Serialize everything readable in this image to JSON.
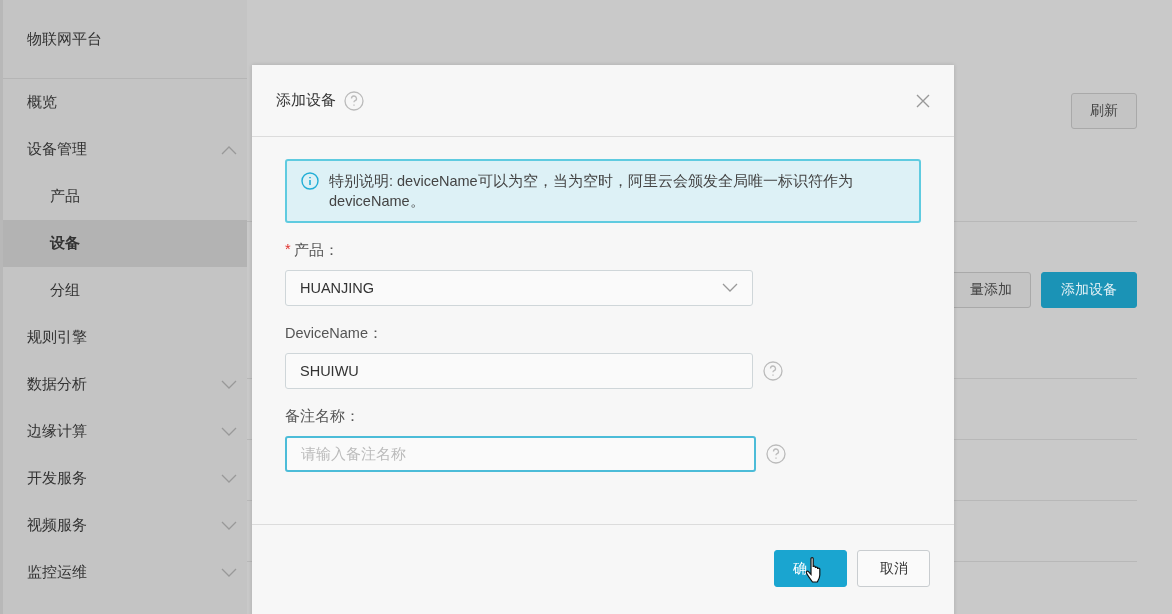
{
  "sidebar": {
    "title": "物联网平台",
    "items": [
      {
        "label": "概览",
        "kind": "link",
        "selected": false
      },
      {
        "label": "设备管理",
        "kind": "group",
        "expanded": true,
        "selected": false,
        "children": [
          {
            "label": "产品",
            "kind": "link",
            "selected": false
          },
          {
            "label": "设备",
            "kind": "link",
            "selected": true
          },
          {
            "label": "分组",
            "kind": "link",
            "selected": false
          }
        ]
      },
      {
        "label": "规则引擎",
        "kind": "link",
        "selected": false
      },
      {
        "label": "数据分析",
        "kind": "group",
        "expanded": false,
        "selected": false
      },
      {
        "label": "边缘计算",
        "kind": "group",
        "expanded": false,
        "selected": false
      },
      {
        "label": "开发服务",
        "kind": "group",
        "expanded": false,
        "selected": false
      },
      {
        "label": "视频服务",
        "kind": "group",
        "expanded": false,
        "selected": false
      },
      {
        "label": "监控运维",
        "kind": "group",
        "expanded": false,
        "selected": false
      }
    ]
  },
  "main": {
    "refresh_button": "刷新",
    "batch_add_button": "量添加",
    "add_device_button": "添加设备"
  },
  "dialog": {
    "title": "添加设备",
    "alert": "特别说明: deviceName可以为空，当为空时，阿里云会颁发全局唯一标识符作为deviceName。",
    "fields": [
      {
        "kind": "select",
        "required_mark": "*",
        "label": "产品：",
        "value": "HUANJING",
        "focused": false
      },
      {
        "kind": "input",
        "label": "DeviceName：",
        "value": "SHUIWU",
        "help": true,
        "focused": false
      },
      {
        "kind": "input",
        "label": "备注名称：",
        "placeholder": "请输入备注名称",
        "help": true,
        "focused": true
      }
    ],
    "confirm_button": "确",
    "cancel_button": "取消"
  }
}
